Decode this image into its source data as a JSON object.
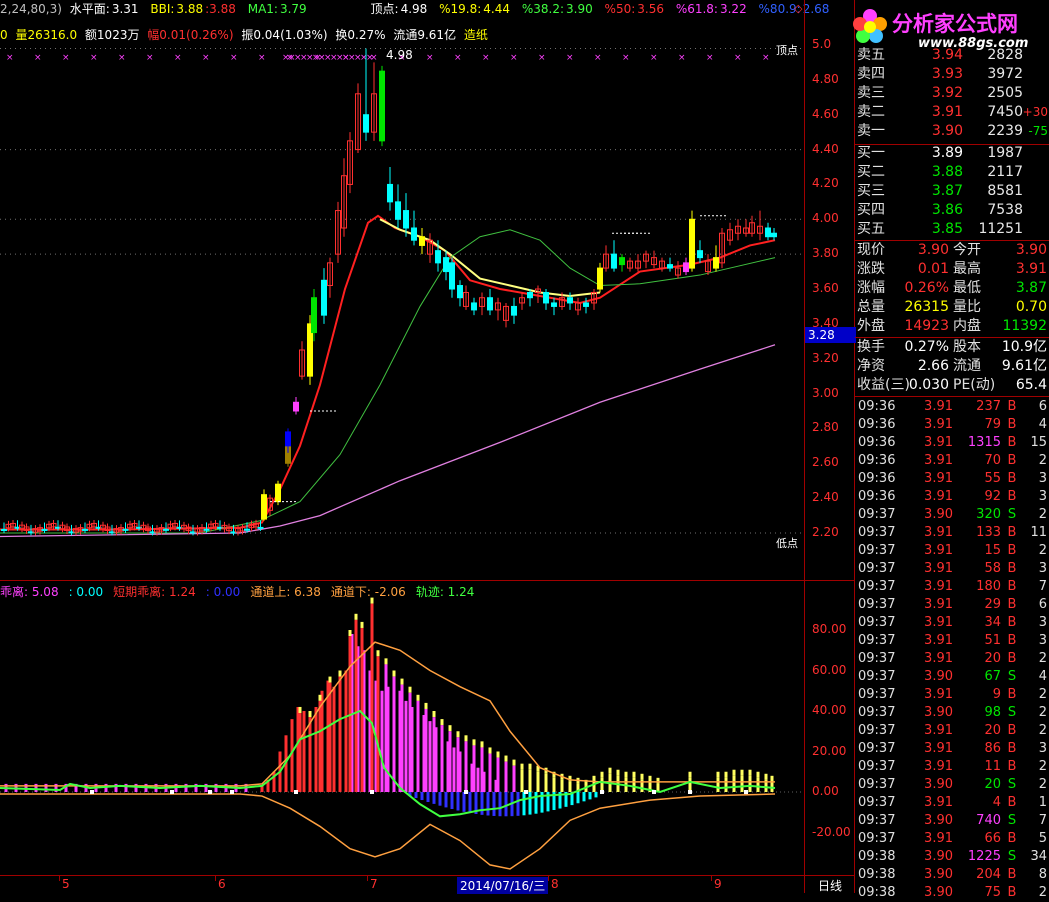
{
  "header1": {
    "params": "2,24,80,3)",
    "level_label": "水平面:",
    "level_val": "3.31",
    "bbi_label": "BBI:",
    "bbi_val": "3.88",
    "bbi_val2": ":3.88",
    "ma1_label": "MA1:",
    "ma1_val": "3.79",
    "top_label": "顶点:",
    "top_val": "4.98",
    "f19_label": "%19.8:",
    "f19_val": "4.44",
    "f38_label": "%38.2:",
    "f38_val": "3.90",
    "f50_label": "%50:",
    "f50_val": "3.56",
    "f61_label": "%61.8:",
    "f61_val": "3.22",
    "f80_label": "%80.9:",
    "f80_val": "2.68"
  },
  "header2": {
    "lead": "0",
    "vol": "量26316.0",
    "amt": "额1023万",
    "chg": "幅0.01(0.26%)",
    "amp": "振0.04(1.03%)",
    "turn": "换0.27%",
    "float": "流通9.61亿",
    "sector": "造纸"
  },
  "main_chart": {
    "high_label": "4.98",
    "top_marker": "顶点",
    "low_marker": "低点",
    "last_price_tag": "3.28",
    "y_ticks": [
      "5.0",
      "4.80",
      "4.60",
      "4.40",
      "4.20",
      "4.00",
      "3.80",
      "3.60",
      "3.40",
      "3.20",
      "3.00",
      "2.80",
      "2.60",
      "2.40",
      "2.20"
    ]
  },
  "indicator": {
    "legend": [
      {
        "text": "乖离: 5.08",
        "color": "#ff40ff"
      },
      {
        "text": ": 0.00",
        "color": "#00ffff"
      },
      {
        "text": "短期乖离: 1.24",
        "color": "#ff3030"
      },
      {
        "text": ": 0.00",
        "color": "#3030ff"
      },
      {
        "text": "通道上: 6.38",
        "color": "#ffa040"
      },
      {
        "text": "通道下: -2.06",
        "color": "#ffa040"
      },
      {
        "text": "轨迹: 1.24",
        "color": "#40ff40"
      }
    ],
    "y_ticks": [
      "80.00",
      "60.00",
      "40.00",
      "20.00",
      "0.00",
      "-20.00"
    ]
  },
  "x_axis": {
    "labels": [
      "5",
      "6",
      "7",
      "2014/07/16/三",
      "8",
      "9"
    ],
    "period": "日线"
  },
  "logo": {
    "title": "分析家公式网",
    "url": "www.88gs.com"
  },
  "order_book": {
    "asks": [
      {
        "label": "卖五",
        "price": "3.94",
        "vol": "2828",
        "chg": ""
      },
      {
        "label": "卖四",
        "price": "3.93",
        "vol": "3972",
        "chg": ""
      },
      {
        "label": "卖三",
        "price": "3.92",
        "vol": "2505",
        "chg": ""
      },
      {
        "label": "卖二",
        "price": "3.91",
        "vol": "7450",
        "chg": "+30"
      },
      {
        "label": "卖一",
        "price": "3.90",
        "vol": "2239",
        "chg": "-75"
      }
    ],
    "bids": [
      {
        "label": "买一",
        "price": "3.89",
        "vol": "1987"
      },
      {
        "label": "买二",
        "price": "3.88",
        "vol": "2117"
      },
      {
        "label": "买三",
        "price": "3.87",
        "vol": "8581"
      },
      {
        "label": "买四",
        "price": "3.86",
        "vol": "7538"
      },
      {
        "label": "买五",
        "price": "3.85",
        "vol": "11251"
      }
    ]
  },
  "quote": {
    "rows1": [
      {
        "l1": "现价",
        "v1": "3.90",
        "l2": "今开",
        "v2": "3.90"
      },
      {
        "l1": "涨跌",
        "v1": "0.01",
        "l2": "最高",
        "v2": "3.91"
      },
      {
        "l1": "涨幅",
        "v1": "0.26%",
        "l2": "最低",
        "v2": "3.87"
      },
      {
        "l1": "总量",
        "v1": "26315",
        "l2": "量比",
        "v2": "0.70"
      },
      {
        "l1": "外盘",
        "v1": "14923",
        "l2": "内盘",
        "v2": "11392"
      }
    ],
    "rows2": [
      {
        "l1": "换手",
        "v1": "0.27%",
        "l2": "股本",
        "v2": "10.9亿"
      },
      {
        "l1": "净资",
        "v1": "2.66",
        "l2": "流通",
        "v2": "9.61亿"
      },
      {
        "l1": "收益(三)",
        "v1": "0.030",
        "l2": "PE(动)",
        "v2": "65.4"
      }
    ]
  },
  "ticks": [
    {
      "t": "09:36",
      "p": "3.91",
      "v": "237",
      "s": "B",
      "n": "6"
    },
    {
      "t": "09:36",
      "p": "3.91",
      "v": "79",
      "s": "B",
      "n": "4"
    },
    {
      "t": "09:36",
      "p": "3.91",
      "v": "1315",
      "s": "B",
      "n": "15"
    },
    {
      "t": "09:36",
      "p": "3.91",
      "v": "70",
      "s": "B",
      "n": "2"
    },
    {
      "t": "09:36",
      "p": "3.91",
      "v": "55",
      "s": "B",
      "n": "3"
    },
    {
      "t": "09:36",
      "p": "3.91",
      "v": "92",
      "s": "B",
      "n": "3"
    },
    {
      "t": "09:37",
      "p": "3.90",
      "v": "320",
      "s": "S",
      "n": "2"
    },
    {
      "t": "09:37",
      "p": "3.91",
      "v": "133",
      "s": "B",
      "n": "11"
    },
    {
      "t": "09:37",
      "p": "3.91",
      "v": "15",
      "s": "B",
      "n": "2"
    },
    {
      "t": "09:37",
      "p": "3.91",
      "v": "58",
      "s": "B",
      "n": "3"
    },
    {
      "t": "09:37",
      "p": "3.91",
      "v": "180",
      "s": "B",
      "n": "7"
    },
    {
      "t": "09:37",
      "p": "3.91",
      "v": "29",
      "s": "B",
      "n": "6"
    },
    {
      "t": "09:37",
      "p": "3.91",
      "v": "34",
      "s": "B",
      "n": "3"
    },
    {
      "t": "09:37",
      "p": "3.91",
      "v": "51",
      "s": "B",
      "n": "3"
    },
    {
      "t": "09:37",
      "p": "3.91",
      "v": "20",
      "s": "B",
      "n": "2"
    },
    {
      "t": "09:37",
      "p": "3.90",
      "v": "67",
      "s": "S",
      "n": "4"
    },
    {
      "t": "09:37",
      "p": "3.91",
      "v": "9",
      "s": "B",
      "n": "2"
    },
    {
      "t": "09:37",
      "p": "3.90",
      "v": "98",
      "s": "S",
      "n": "2"
    },
    {
      "t": "09:37",
      "p": "3.91",
      "v": "20",
      "s": "B",
      "n": "2"
    },
    {
      "t": "09:37",
      "p": "3.91",
      "v": "86",
      "s": "B",
      "n": "3"
    },
    {
      "t": "09:37",
      "p": "3.91",
      "v": "11",
      "s": "B",
      "n": "2"
    },
    {
      "t": "09:37",
      "p": "3.90",
      "v": "20",
      "s": "S",
      "n": "2"
    },
    {
      "t": "09:37",
      "p": "3.91",
      "v": "4",
      "s": "B",
      "n": "1"
    },
    {
      "t": "09:37",
      "p": "3.90",
      "v": "740",
      "s": "S",
      "n": "7"
    },
    {
      "t": "09:37",
      "p": "3.91",
      "v": "66",
      "s": "B",
      "n": "5"
    },
    {
      "t": "09:38",
      "p": "3.90",
      "v": "1225",
      "s": "S",
      "n": "34"
    },
    {
      "t": "09:38",
      "p": "3.90",
      "v": "204",
      "s": "B",
      "n": "8"
    },
    {
      "t": "09:38",
      "p": "3.90",
      "v": "75",
      "s": "B",
      "n": "2"
    }
  ],
  "colors": {
    "up": "#ff3030",
    "down": "#00e600",
    "grid": "#a00000",
    "price_white": "#ffffff"
  }
}
